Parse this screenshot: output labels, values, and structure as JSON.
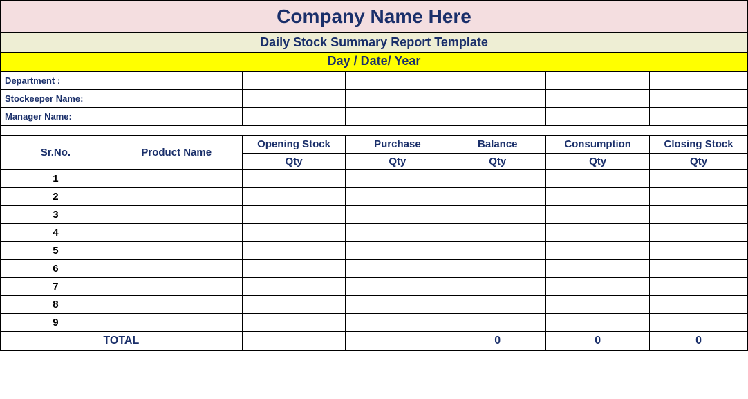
{
  "title": "Company Name Here",
  "subtitle": "Daily Stock Summary Report Template",
  "date_label": "Day / Date/ Year",
  "meta": {
    "department_label": "Department :",
    "stockkeeper_label": "Stockeeper Name:",
    "manager_label": "Manager Name:"
  },
  "headers": {
    "srno": "Sr.No.",
    "product": "Product Name",
    "opening": "Opening Stock",
    "purchase": "Purchase",
    "balance": "Balance",
    "consumption": "Consumption",
    "closing": "Closing Stock",
    "qty": "Qty"
  },
  "rows": [
    "1",
    "2",
    "3",
    "4",
    "5",
    "6",
    "7",
    "8",
    "9"
  ],
  "total": {
    "label": "TOTAL",
    "balance": "0",
    "consumption": "0",
    "closing": "0"
  }
}
